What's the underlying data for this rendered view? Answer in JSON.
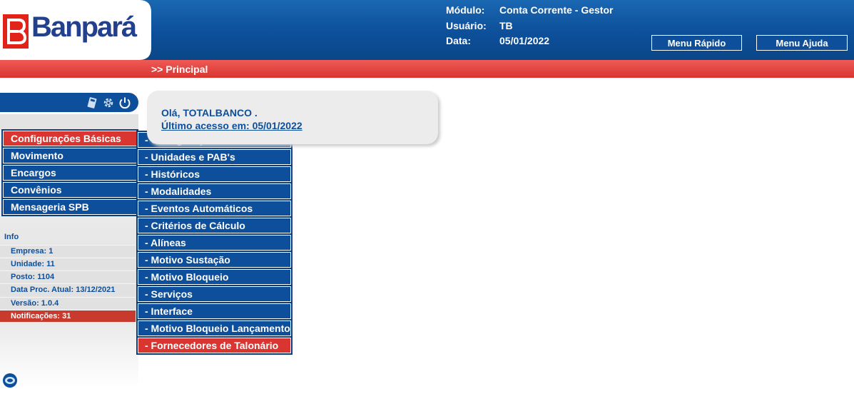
{
  "header": {
    "logo_text": "Banpará",
    "module_label": "Módulo:",
    "module_value": "Conta Corrente - Gestor",
    "user_label": "Usuário:",
    "user_value": "TB",
    "date_label": "Data:",
    "date_value": "05/01/2022",
    "quick_menu_label": "Menu Rápido",
    "help_menu_label": "Menu Ajuda"
  },
  "breadcrumb": ">> Principal",
  "toolbar_icons": [
    "calculator-icon",
    "gear-icon",
    "power-icon"
  ],
  "menu": {
    "items": [
      {
        "label": "Configurações Básicas",
        "active": true
      },
      {
        "label": "Movimento"
      },
      {
        "label": "Encargos"
      },
      {
        "label": "Convênios"
      },
      {
        "label": "Mensageria SPB"
      }
    ]
  },
  "submenu": {
    "items": [
      "- Configurações Globais",
      "- Unidades e PAB's",
      "- Históricos",
      "- Modalidades",
      "- Eventos Automáticos",
      "- Critérios de Cálculo",
      "- Alíneas",
      "- Motivo Sustação",
      "- Motivo Bloqueio",
      "- Serviços",
      "- Interface",
      "- Motivo Bloqueio Lançamento",
      "- Fornecedores de Talonário"
    ]
  },
  "info": {
    "title": "Info",
    "company": "Empresa: 1",
    "unit": "Unidade: 11",
    "post": "Posto: 1104",
    "proc_date": "Data Proc. Atual: 13/12/2021",
    "version": "Versão: 1.0.4",
    "notifications": "Notificações: 31"
  },
  "welcome": {
    "greeting": "Olá, TOTALBANCO .",
    "last_access": "Último acesso em:  05/01/2022"
  },
  "colors": {
    "brand_blue": "#0d4f9a",
    "brand_red": "#d93531"
  }
}
